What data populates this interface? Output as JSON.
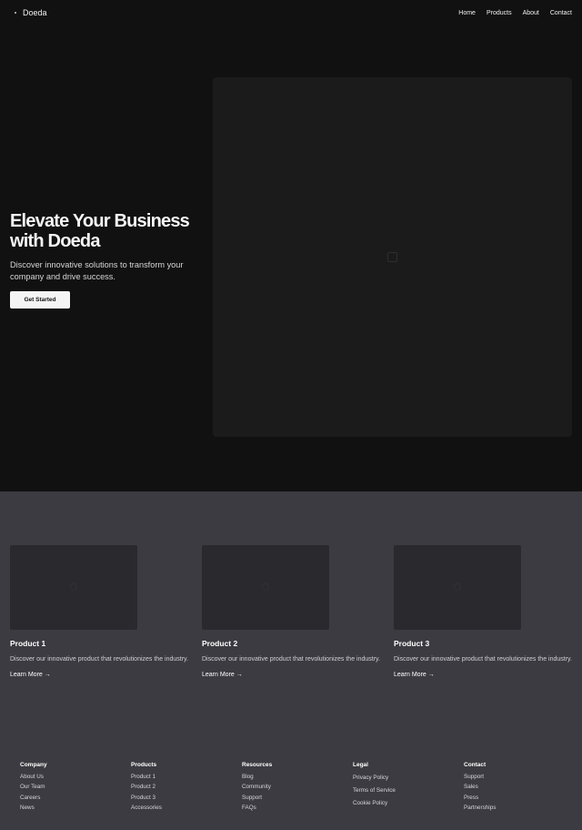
{
  "header": {
    "brand": "Doeda",
    "nav": [
      "Home",
      "Products",
      "About",
      "Contact"
    ]
  },
  "hero": {
    "title": "Elevate Your Business with Doeda",
    "subtitle": "Discover innovative solutions to transform your company and drive success.",
    "cta_label": "Get Started"
  },
  "products": [
    {
      "title": "Product 1",
      "description": "Discover our innovative product that revolutionizes the industry.",
      "link": "Learn More →"
    },
    {
      "title": "Product 2",
      "description": "Discover our innovative product that revolutionizes the industry.",
      "link": "Learn More →"
    },
    {
      "title": "Product 3",
      "description": "Discover our innovative product that revolutionizes the industry.",
      "link": "Learn More →"
    }
  ],
  "footer": {
    "columns": [
      {
        "heading": "Company",
        "links": [
          "About Us",
          "Our Team",
          "Careers",
          "News"
        ]
      },
      {
        "heading": "Products",
        "links": [
          "Product 1",
          "Product 2",
          "Product 3",
          "Accessories"
        ]
      },
      {
        "heading": "Resources",
        "links": [
          "Blog",
          "Community",
          "Support",
          "FAQs"
        ]
      },
      {
        "heading": "Legal",
        "links": [
          "Privacy Policy",
          "Terms of Service",
          "Cookie Policy"
        ]
      },
      {
        "heading": "Contact",
        "links": [
          "Support",
          "Sales",
          "Press",
          "Partnerships"
        ]
      }
    ]
  }
}
